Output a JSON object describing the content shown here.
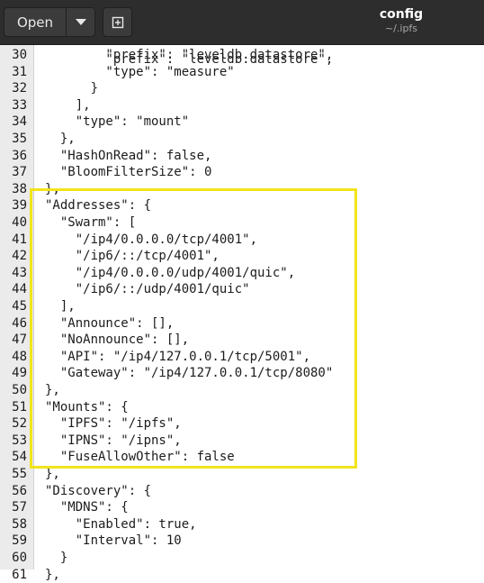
{
  "toolbar": {
    "open_label": "Open",
    "menu_icon": "chevron-down-icon",
    "new_document_icon": "new-document-icon"
  },
  "window": {
    "title": "config",
    "subtitle": "~/.ipfs"
  },
  "colors": {
    "titlebar": "#2d2d2d",
    "editor_background": "#ffffff",
    "gutter_background": "#ebebeb",
    "highlight_box": "#f2e41b"
  },
  "editor": {
    "top_partial_line": "        \"prefix\": \"leveldb.datastore\",",
    "lines": [
      {
        "num": "30",
        "text": "        \"prefix\": \"leveldb.datastore\","
      },
      {
        "num": "31",
        "text": "        \"type\": \"measure\""
      },
      {
        "num": "32",
        "text": "      }"
      },
      {
        "num": "33",
        "text": "    ],"
      },
      {
        "num": "34",
        "text": "    \"type\": \"mount\""
      },
      {
        "num": "35",
        "text": "  },"
      },
      {
        "num": "36",
        "text": "  \"HashOnRead\": false,"
      },
      {
        "num": "37",
        "text": "  \"BloomFilterSize\": 0"
      },
      {
        "num": "38",
        "text": "},"
      },
      {
        "num": "39",
        "text": "\"Addresses\": {"
      },
      {
        "num": "40",
        "text": "  \"Swarm\": ["
      },
      {
        "num": "41",
        "text": "    \"/ip4/0.0.0.0/tcp/4001\","
      },
      {
        "num": "42",
        "text": "    \"/ip6/::/tcp/4001\","
      },
      {
        "num": "43",
        "text": "    \"/ip4/0.0.0.0/udp/4001/quic\","
      },
      {
        "num": "44",
        "text": "    \"/ip6/::/udp/4001/quic\""
      },
      {
        "num": "45",
        "text": "  ],"
      },
      {
        "num": "46",
        "text": "  \"Announce\": [],"
      },
      {
        "num": "47",
        "text": "  \"NoAnnounce\": [],"
      },
      {
        "num": "48",
        "text": "  \"API\": \"/ip4/127.0.0.1/tcp/5001\","
      },
      {
        "num": "49",
        "text": "  \"Gateway\": \"/ip4/127.0.0.1/tcp/8080\""
      },
      {
        "num": "50",
        "text": "},"
      },
      {
        "num": "51",
        "text": "\"Mounts\": {"
      },
      {
        "num": "52",
        "text": "  \"IPFS\": \"/ipfs\","
      },
      {
        "num": "53",
        "text": "  \"IPNS\": \"/ipns\","
      },
      {
        "num": "54",
        "text": "  \"FuseAllowOther\": false"
      },
      {
        "num": "55",
        "text": "},"
      },
      {
        "num": "56",
        "text": "\"Discovery\": {"
      },
      {
        "num": "57",
        "text": "  \"MDNS\": {"
      },
      {
        "num": "58",
        "text": "    \"Enabled\": true,"
      },
      {
        "num": "59",
        "text": "    \"Interval\": 10"
      },
      {
        "num": "60",
        "text": "  }"
      },
      {
        "num": "61",
        "text": "},"
      }
    ]
  }
}
